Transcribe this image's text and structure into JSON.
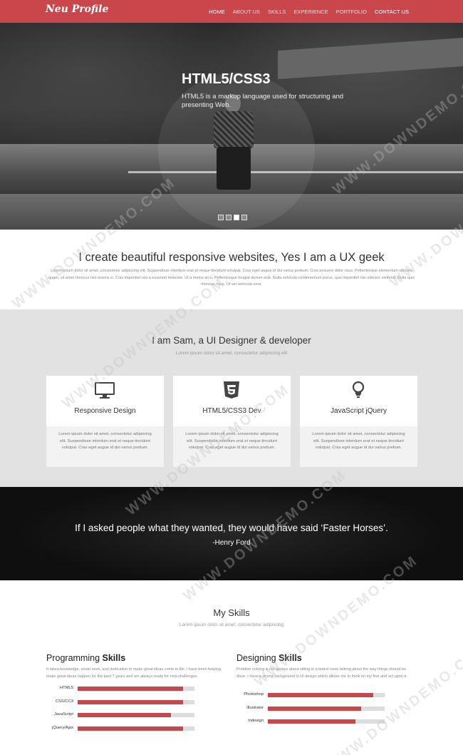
{
  "brand": {
    "logo": "Neu Profile",
    "accent": "#c9464b"
  },
  "nav": {
    "items": [
      {
        "label": "HOME",
        "active": true
      },
      {
        "label": "ABOUT US"
      },
      {
        "label": "SKILLS"
      },
      {
        "label": "EXPERIENCE"
      },
      {
        "label": "PORTFOLIO"
      },
      {
        "label": "CONTACT US"
      }
    ]
  },
  "hero": {
    "title": "HTML5/CSS3",
    "subtitle": "HTML5 is a markup language used for structuring and presenting Web.",
    "slides": 4,
    "active_slide": 3
  },
  "intro": {
    "title": "I create beautiful responsive websites, Yes I am a UX geek",
    "body": "Lorem ipsum dolor sit amet, consectetur adipiscing elit. Suspendisse interdum erat et neque tincidunt volutpat. Cras eget augue id dui varius pretium. Cras posuere dolor risus. Pellentesque elementum ultricies quam, sit amet rhoncus nisl viverra vi. Cras imperdiet nisi a euismod molestie. Ut a metus arcu. Pellentesque feugiat dictum erat. Nulla vehicula condimentum purus, quis imperdiet nisi ultricies eleifend. Nulla quis rhoncus risus. Ut vel vehicula urna."
  },
  "about": {
    "title": "I am Sam, a UI Designer & developer",
    "subtitle": "Lorem ipsum dolor sit amet, consectetur adipiscing elit",
    "cards": [
      {
        "icon": "monitor-icon",
        "title": "Responsive Design",
        "body": "Lorem ipsum dolor sit amet, consectetur adipiscing elit. Suspendisse interdum erat et neque tincidunt volutpat. Cras eget augue id dui varius pretium."
      },
      {
        "icon": "css3-icon",
        "title": "HTML5/CSS3 Dev",
        "body": "Lorem ipsum dolor sit amet, consectetur adipiscing elit. Suspendisse interdum erat et neque tincidunt volutpat. Cras eget augue id dui varius pretium."
      },
      {
        "icon": "lightbulb-icon",
        "title": "JavaScript jQuery",
        "body": "Lorem ipsum dolor sit amet, consectetur adipiscing elit. Suspendisse interdum erat et neque tincidunt volutpat. Cras eget augue id dui varius pretium."
      }
    ]
  },
  "quote": {
    "text": "If I asked people what they wanted, they would have said ‘Faster Horses’.",
    "author": "-Henry Ford"
  },
  "skills": {
    "title": "My Skills",
    "subtitle": "Lorem ipsum dolor sit amet, consectetur adipiscing",
    "programming": {
      "title_plain": "Programming ",
      "title_bold": "Skills",
      "desc": "It takes knowledge, smart work, and dedication to make great ideas come to life. I have been helping make great ideas happen for the past 7 years and am always ready for new challenges.",
      "bars": [
        {
          "label": "HTML5",
          "percent": 90
        },
        {
          "label": "CSS/CC3",
          "percent": 90
        },
        {
          "label": "JavaScript",
          "percent": 80
        },
        {
          "label": "jQuery/Ajax",
          "percent": 90
        }
      ]
    },
    "designing": {
      "title_plain": "Designing ",
      "title_bold": "Skills",
      "desc": "Problem solving is not always about sitting in a board room talking about the way things should be done. I have a strong background in UI design which allows me to think on my feet and act upon it.",
      "bars": [
        {
          "label": "Photoshop",
          "percent": 90
        },
        {
          "label": "Illustrator",
          "percent": 80
        },
        {
          "label": "Indesign",
          "percent": 75
        }
      ]
    }
  },
  "watermark": "WWW.DOWNDEMO.COM"
}
